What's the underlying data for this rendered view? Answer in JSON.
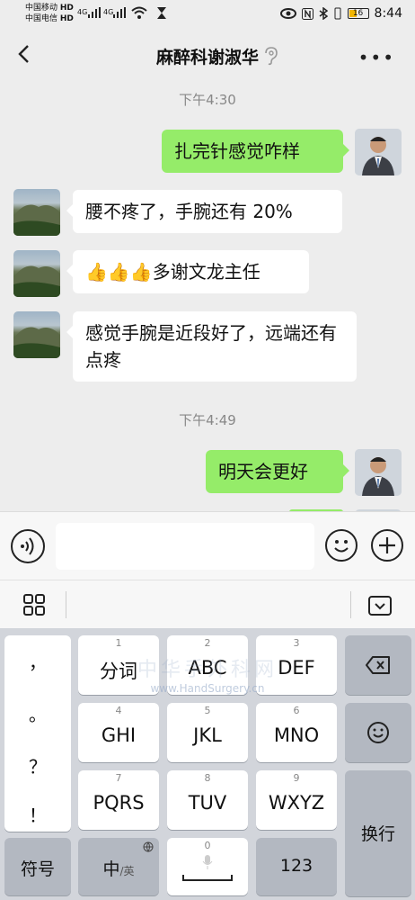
{
  "status_bar": {
    "carrier1": "中国移动",
    "carrier2": "中国电信",
    "hd": "HD",
    "net1": "4G",
    "net2": "4G",
    "battery": "16",
    "time": "8:44"
  },
  "header": {
    "title": "麻醉科谢淑华"
  },
  "chat": {
    "time1": "下午4:30",
    "time2": "下午4:49",
    "messages": [
      {
        "from": "me",
        "text": "扎完针感觉咋样"
      },
      {
        "from": "other",
        "text": "腰不疼了，手腕还有 20%"
      },
      {
        "from": "other",
        "emoji": "👍👍👍",
        "text": "多谢文龙主任"
      },
      {
        "from": "other",
        "text": "感觉手腕是近段好了，远端还有点疼"
      },
      {
        "from": "me",
        "text": "明天会更好"
      }
    ]
  },
  "input": {
    "value": ""
  },
  "keyboard": {
    "punct": [
      "，",
      "。",
      "？",
      "！"
    ],
    "keys": [
      {
        "num": "1",
        "label": "分词"
      },
      {
        "num": "2",
        "label": "ABC"
      },
      {
        "num": "3",
        "label": "DEF"
      },
      {
        "num": "4",
        "label": "GHI"
      },
      {
        "num": "5",
        "label": "JKL"
      },
      {
        "num": "6",
        "label": "MNO"
      },
      {
        "num": "7",
        "label": "PQRS"
      },
      {
        "num": "8",
        "label": "TUV"
      },
      {
        "num": "9",
        "label": "WXYZ"
      }
    ],
    "symbols": "符号",
    "lang_main": "中",
    "lang_alt": "/英",
    "space_num": "0",
    "numbers": "123",
    "enter": "换行"
  },
  "watermark": {
    "site": "www.HandSurgery.cn",
    "name": "中华手外科网"
  }
}
